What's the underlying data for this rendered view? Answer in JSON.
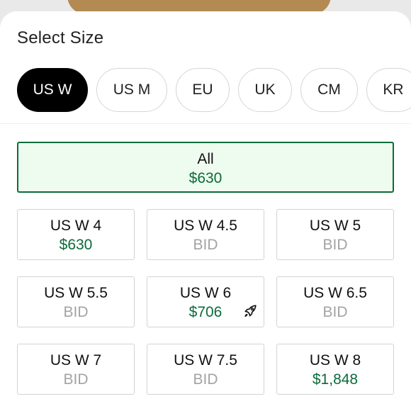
{
  "sheet": {
    "title": "Select Size"
  },
  "size_systems": [
    {
      "label": "US W",
      "selected": true
    },
    {
      "label": "US M",
      "selected": false
    },
    {
      "label": "EU",
      "selected": false
    },
    {
      "label": "UK",
      "selected": false
    },
    {
      "label": "CM",
      "selected": false
    },
    {
      "label": "KR",
      "selected": false
    }
  ],
  "all_sizes": {
    "label": "All",
    "price": "$630"
  },
  "sizes": [
    {
      "label": "US W 4",
      "price": "$630",
      "status": "ask"
    },
    {
      "label": "US W 4.5",
      "price": "BID",
      "status": "bid"
    },
    {
      "label": "US W 5",
      "price": "BID",
      "status": "bid"
    },
    {
      "label": "US W 5.5",
      "price": "BID",
      "status": "bid"
    },
    {
      "label": "US W 6",
      "price": "$706",
      "status": "ask",
      "icon": "rocket-icon"
    },
    {
      "label": "US W 6.5",
      "price": "BID",
      "status": "bid"
    },
    {
      "label": "US W 7",
      "price": "BID",
      "status": "bid"
    },
    {
      "label": "US W 7.5",
      "price": "BID",
      "status": "bid"
    },
    {
      "label": "US W 8",
      "price": "$1,848",
      "status": "ask"
    }
  ],
  "colors": {
    "accent_green": "#0b6b3a",
    "selected_tile_bg": "#eefbef",
    "bid_gray": "#a3a3a3",
    "chip_active_bg": "#000000"
  }
}
